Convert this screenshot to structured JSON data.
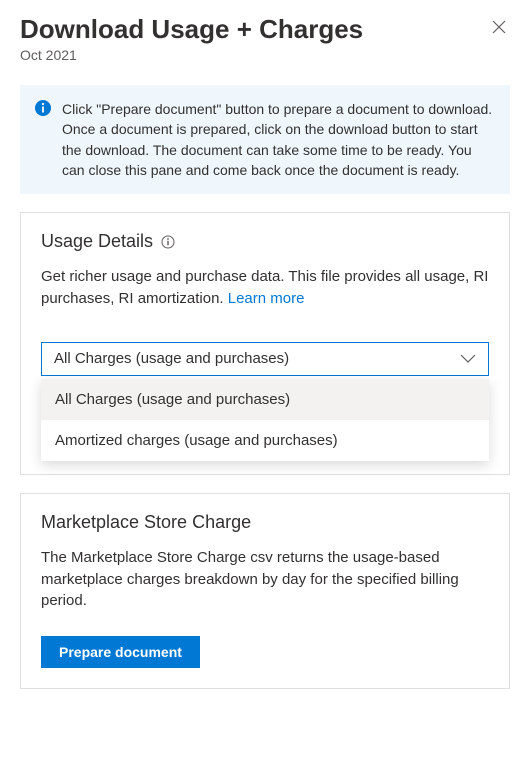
{
  "header": {
    "title": "Download Usage + Charges",
    "subtitle": "Oct 2021"
  },
  "info_banner": {
    "text": "Click \"Prepare document\" button to prepare a document to download. Once a document is prepared, click on the download button to start the download. The document can take some time to be ready. You can close this pane and come back once the document is ready."
  },
  "usage_details": {
    "title": "Usage Details",
    "description": "Get richer usage and purchase data. This file provides all usage, RI purchases, RI amortization. ",
    "learn_more_label": "Learn more",
    "selected": "All Charges (usage and purchases)",
    "options": [
      "All Charges (usage and purchases)",
      "Amortized charges (usage and purchases)"
    ]
  },
  "marketplace": {
    "title": "Marketplace Store Charge",
    "description": "The Marketplace Store Charge csv returns the usage-based marketplace charges breakdown by day for the specified billing period.",
    "button_label": "Prepare document"
  }
}
